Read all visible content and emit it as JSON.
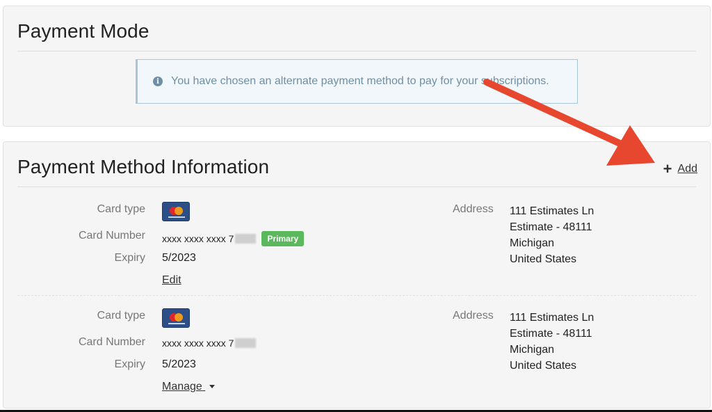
{
  "payment_mode": {
    "title": "Payment Mode",
    "alert_text": "You have chosen an alternate payment method to pay for your subscriptions."
  },
  "payment_info": {
    "title": "Payment Method Information",
    "add_label": "Add"
  },
  "labels": {
    "card_type": "Card type",
    "card_number": "Card Number",
    "expiry": "Expiry",
    "address": "Address"
  },
  "cards": [
    {
      "card_number": "xxxx xxxx xxxx 7",
      "badge": "Primary",
      "expiry": "5/2023",
      "action": "Edit",
      "address_lines": [
        "111 Estimates Ln",
        "Estimate - 48111",
        "Michigan",
        "United States"
      ]
    },
    {
      "card_number": "xxxx xxxx xxxx 7",
      "expiry": "5/2023",
      "action": "Manage",
      "address_lines": [
        "111 Estimates Ln",
        "Estimate - 48111",
        "Michigan",
        "United States"
      ]
    }
  ],
  "icons": {
    "info": "info-icon",
    "plus": "plus-icon",
    "card": "mastercard-icon",
    "caret": "caret-down-icon"
  },
  "colors": {
    "arrow": "#e8472f",
    "badge_primary": "#5cb85c",
    "alert_text": "#6e8fa6",
    "panel_bg": "#f5f5f5"
  }
}
